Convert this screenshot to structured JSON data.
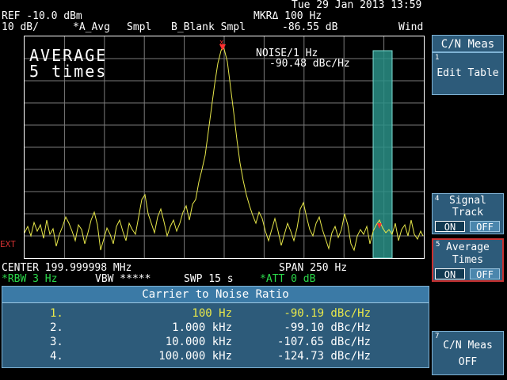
{
  "header": {
    "datetime": "Tue 29 Jan 2013 13:59",
    "ref_level": "REF -10.0 dBm",
    "scale": "10 dB/",
    "trace_a": "*A_Avg",
    "smpl_a": "Smpl",
    "trace_b": "B_Blank Smpl",
    "marker_label": "MKRΔ 100 Hz",
    "marker_value": "-86.55 dB",
    "wind": "Wind"
  },
  "plot": {
    "avg_line1": "AVERAGE",
    "avg_line2": "5 times",
    "noise_label": "NOISE/1 Hz",
    "noise_value": "-90.48 dBc/Hz",
    "ext_label": "EXT",
    "colors": {
      "trace": "#e8e84a",
      "grid": "#7a7a7a",
      "band": "#2a8f86",
      "marker": "#ff3030"
    }
  },
  "footer": {
    "center": "CENTER 199.999998 MHz",
    "span": "SPAN 250 Hz",
    "rbw": "*RBW 3 Hz",
    "vbw": "VBW *****",
    "swp": "SWP 15 s",
    "att": "*ATT 0 dB"
  },
  "table": {
    "title": "Carrier to Noise Ratio",
    "rows": [
      {
        "index": "1.",
        "offset": "100 Hz",
        "value": "-90.19 dBc/Hz"
      },
      {
        "index": "2.",
        "offset": "1.000 kHz",
        "value": "-99.10 dBc/Hz"
      },
      {
        "index": "3.",
        "offset": "10.000 kHz",
        "value": "-107.65 dBc/Hz"
      },
      {
        "index": "4.",
        "offset": "100.000 kHz",
        "value": "-124.73 dBc/Hz"
      }
    ]
  },
  "softkeys": {
    "menu_title": "C/N Meas",
    "k1": {
      "num": "1",
      "label": "Edit Table"
    },
    "k4": {
      "num": "4",
      "line1": "Signal",
      "line2": "Track",
      "on": "ON",
      "off": "OFF"
    },
    "k5": {
      "num": "5",
      "line1": "Average",
      "line2": "Times",
      "on": "ON",
      "off": "OFF"
    },
    "k7": {
      "num": "7",
      "line1": "C/N Meas",
      "line2": "OFF"
    }
  }
}
